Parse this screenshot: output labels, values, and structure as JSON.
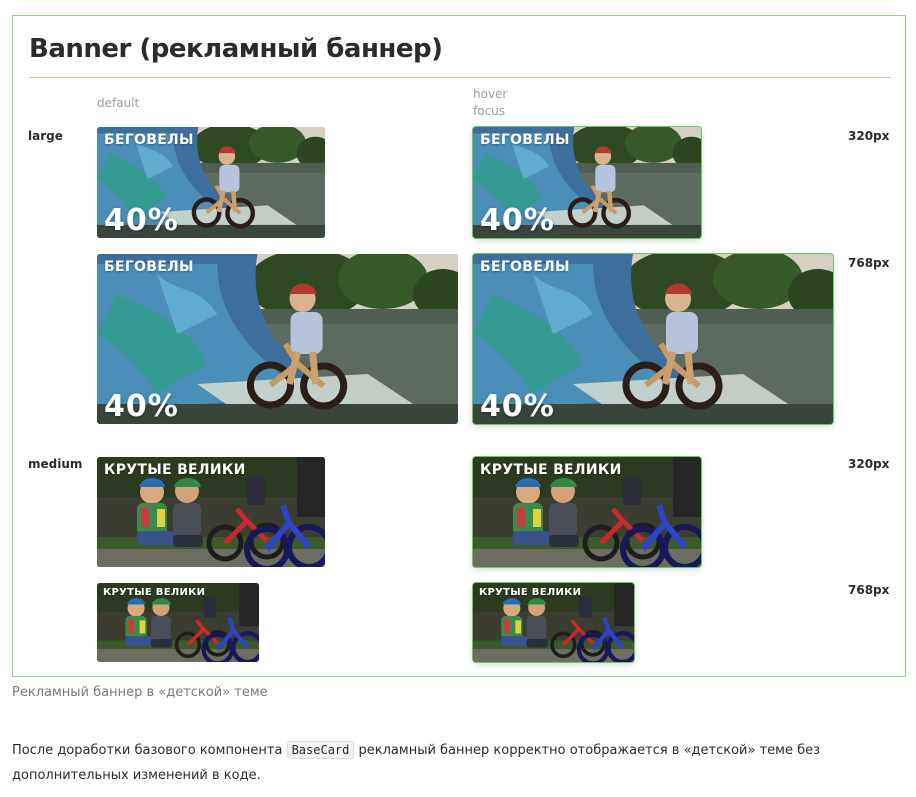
{
  "title": "Banner (рекламный баннер)",
  "states": {
    "default": "default",
    "hover": "hover",
    "focus": "focus"
  },
  "sizes": {
    "large": "large",
    "medium": "medium"
  },
  "widths": {
    "w320": "320px",
    "w768": "768px"
  },
  "banners": {
    "bikes_headline": "БЕГОВЕЛЫ",
    "bikes_discount": "40%",
    "cool_headline": "КРУТЫЕ ВЕЛИКИ"
  },
  "caption": "Рекламный баннер в «детской» теме",
  "description": {
    "before": "После доработки базового компонента ",
    "code": "BaseCard",
    "after": " рекламный баннер корректно отображается в «детской» теме без дополнительных изменений в коде."
  },
  "colors": {
    "frame_border": "#8fd08a",
    "hover_outline": "#6ac864"
  }
}
